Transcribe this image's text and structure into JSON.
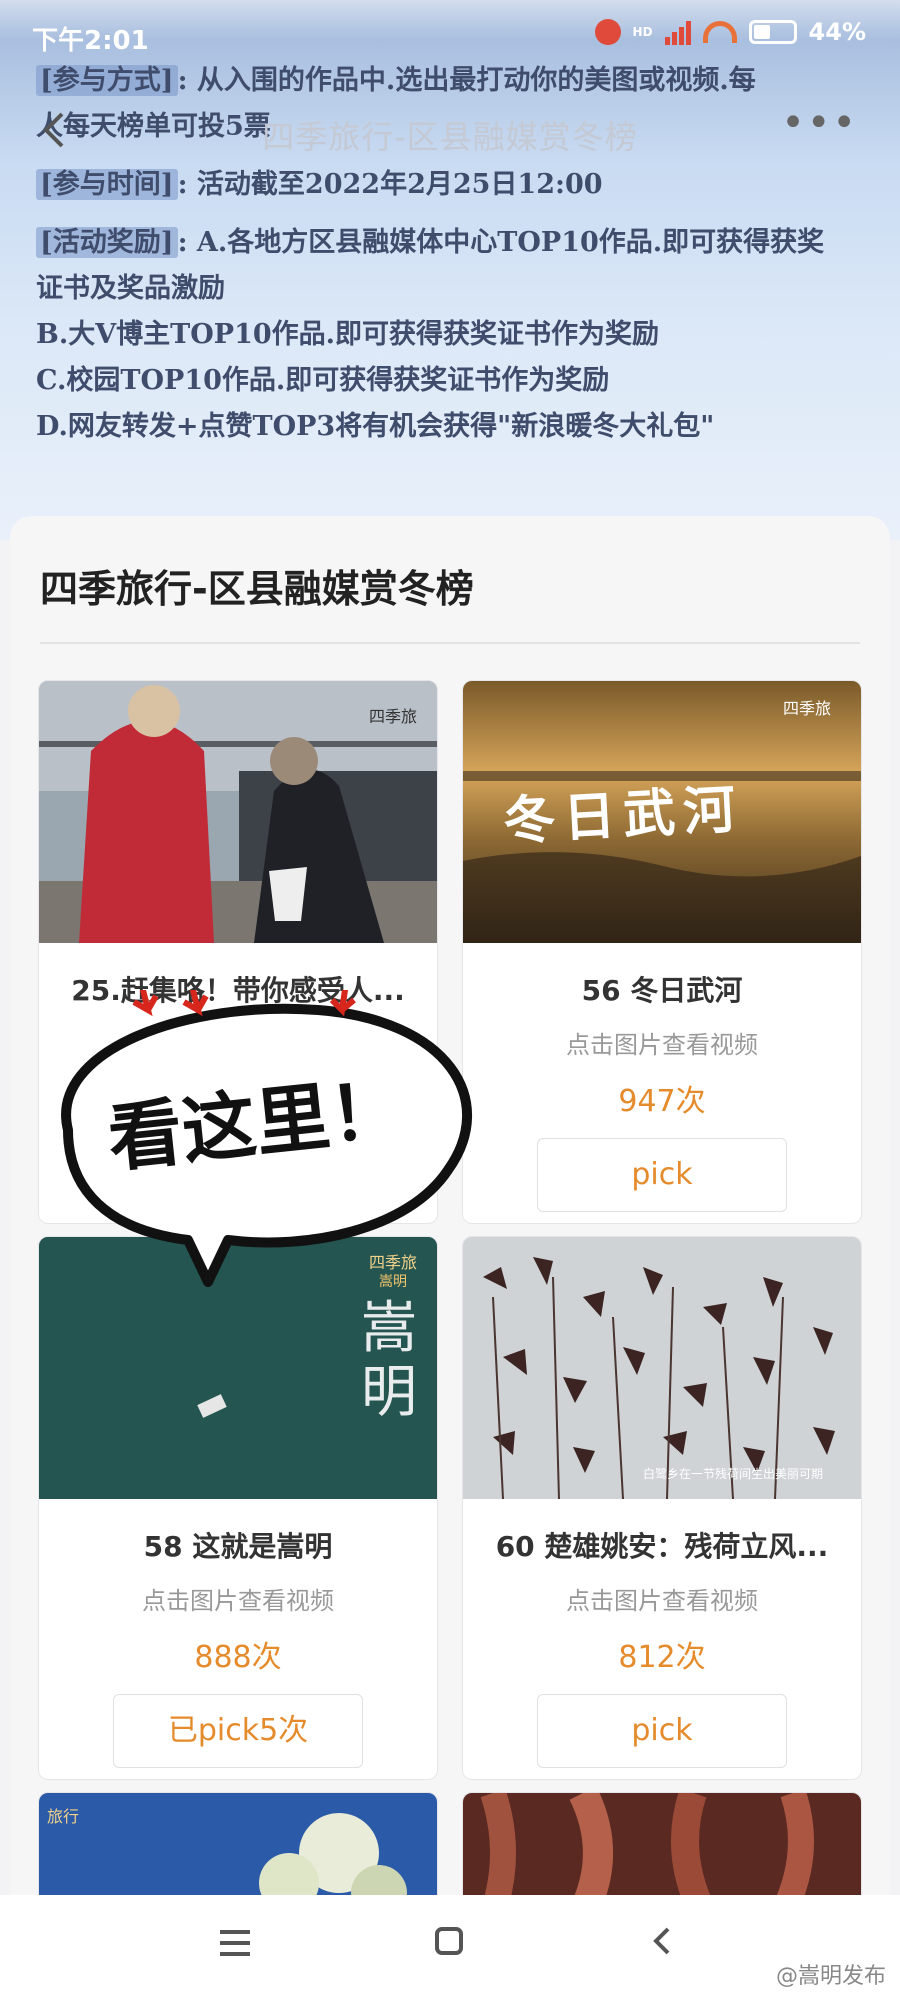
{
  "status_bar": {
    "time": "下午2:01",
    "hd": "HD",
    "battery": "44%"
  },
  "nav": {
    "back_icon": "chevron-left-icon",
    "title": "四季旅行-区县融媒赏冬榜",
    "more": "•••"
  },
  "rules": {
    "line1_tag": "[参与方式]",
    "line1_text": ": 从入围的作品中.选出最打动你的美图或视频.每",
    "line2": "人每天榜单可投5票",
    "line3_tag": "[参与时间]",
    "line3_text": ": 活动截至2022年2月25日12:00",
    "line4_tag": "[活动奖励]",
    "line4_text": ": A.各地方区县融媒体中心TOP10作品.即可获得获奖",
    "line5": "证书及奖品激励",
    "line6": "B.大V博主TOP10作品.即可获得获奖证书作为奖励",
    "line7": "C.校园TOP10作品.即可获得获奖证书作为奖励",
    "line8": "D.网友转发+点赞TOP3将有机会获得\"新浪暖冬大礼包\""
  },
  "list_title": "四季旅行-区县融媒赏冬榜",
  "cards": [
    {
      "title": "25.赶集咯！带你感受人...",
      "hint": "",
      "count": "",
      "button": ""
    },
    {
      "title": "56 冬日武河",
      "hint": "点击图片查看视频",
      "count": "947次",
      "button": "pick",
      "overlay": "冬日武河",
      "wm": "四季旅"
    },
    {
      "title": "58 这就是嵩明",
      "hint": "点击图片查看视频",
      "count": "888次",
      "button": "已pick5次",
      "wm": "四季旅"
    },
    {
      "title": "60 楚雄姚安：残荷立风...",
      "hint": "点击图片查看视频",
      "count": "812次",
      "button": "pick"
    }
  ],
  "card1_wm": "四季旅",
  "card3_vertical_text": "嵩明",
  "card3_corner": "嵩明",
  "card4_caption": "白鹭乡在一节残荷间生出美丽可期",
  "card5_wm": "旅行",
  "annotation": "看这里！",
  "watermark": "@嵩明发布",
  "colors": {
    "accent": "#e58b2c",
    "banner_top": "#9fb6d9",
    "banner_bottom": "#e9f0fa"
  }
}
